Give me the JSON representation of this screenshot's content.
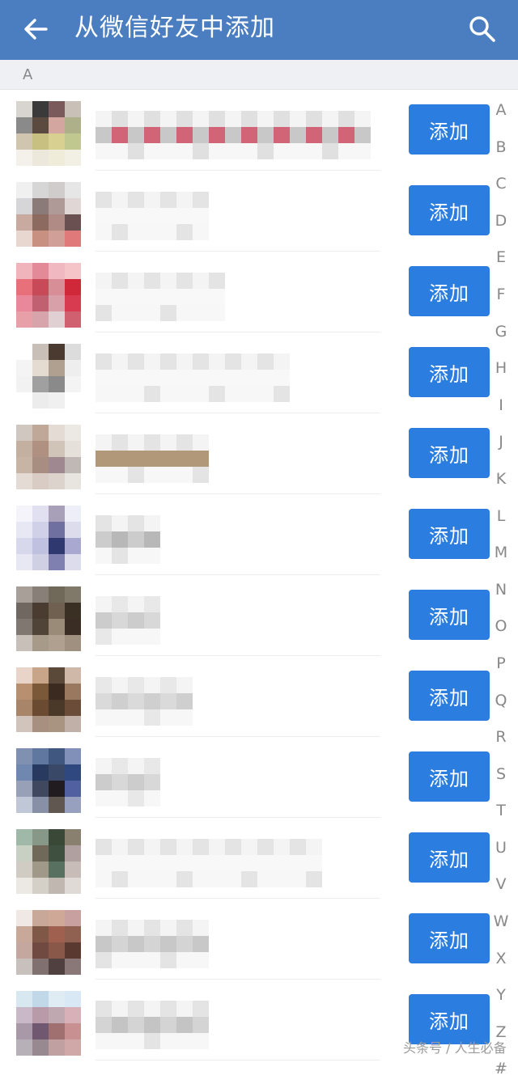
{
  "header": {
    "title": "从微信好友中添加",
    "back_icon": "back-arrow-icon",
    "search_icon": "search-icon",
    "bg": "#4a7ec0"
  },
  "section": {
    "label": "A"
  },
  "add_label": "添加",
  "accent": "#2b7de0",
  "contacts": [
    {
      "add_label": "添加"
    },
    {
      "add_label": "添加"
    },
    {
      "add_label": "添加"
    },
    {
      "add_label": "添加"
    },
    {
      "add_label": "添加"
    },
    {
      "add_label": "添加"
    },
    {
      "add_label": "添加"
    },
    {
      "add_label": "添加"
    },
    {
      "add_label": "添加"
    },
    {
      "add_label": "添加"
    },
    {
      "add_label": "添加"
    },
    {
      "add_label": "添加"
    }
  ],
  "index_letters": [
    "A",
    "B",
    "C",
    "D",
    "E",
    "F",
    "G",
    "H",
    "I",
    "J",
    "K",
    "L",
    "M",
    "N",
    "O",
    "P",
    "Q",
    "R",
    "S",
    "T",
    "U",
    "V",
    "W",
    "X",
    "Y",
    "Z",
    "#"
  ],
  "watermark": "头条号 / 人生必备"
}
